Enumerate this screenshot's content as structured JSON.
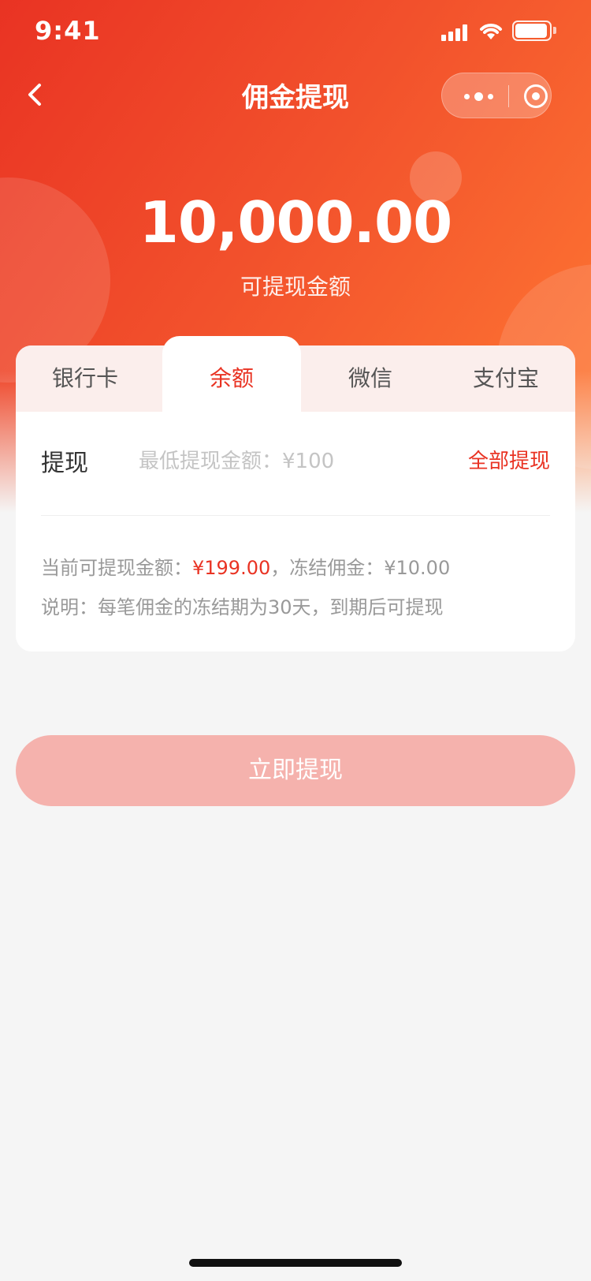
{
  "status_bar": {
    "time": "9:41"
  },
  "nav": {
    "title": "佣金提现",
    "back_icon": "chevron-left-icon",
    "more_icon": "more-dots-icon",
    "close_icon": "target-icon"
  },
  "hero": {
    "amount": "10,000.00",
    "amount_label": "可提现金额"
  },
  "tabs": [
    {
      "label": "银行卡"
    },
    {
      "label": "余额",
      "active": true
    },
    {
      "label": "微信"
    },
    {
      "label": "支付宝"
    }
  ],
  "withdraw": {
    "label": "提现",
    "placeholder": "最低提现金额：¥100",
    "all_label": "全部提现"
  },
  "info": {
    "current_prefix": "当前可提现金额：",
    "current_value": "¥199.00",
    "frozen": "，冻结佣金：¥10.00",
    "note": "说明：每笔佣金的冻结期为30天，到期后可提现"
  },
  "submit": {
    "label": "立即提现"
  },
  "colors": {
    "accent": "#e93323",
    "hero_end": "#ff7a33",
    "button_disabled": "#f5b2ad",
    "background": "#f5f5f5"
  }
}
